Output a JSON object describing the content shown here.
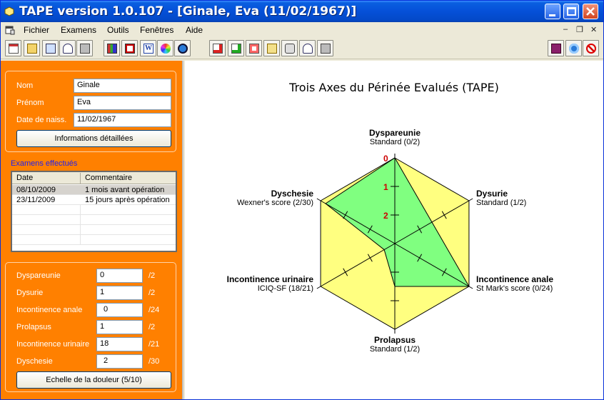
{
  "window": {
    "title": "TAPE version 1.0.107 - [Ginale, Eva (11/02/1967)]"
  },
  "menu": {
    "items": [
      "Fichier",
      "Examens",
      "Outils",
      "Fenêtres",
      "Aide"
    ]
  },
  "patient": {
    "nom_label": "Nom",
    "nom": "Ginale",
    "prenom_label": "Prénom",
    "prenom": "Eva",
    "naiss_label": "Date de naiss.",
    "naiss": "11/02/1967",
    "details_button": "Informations détaillées"
  },
  "exams": {
    "title": "Examens effectués",
    "col_date": "Date",
    "col_comment": "Commentaire",
    "rows": [
      {
        "date": "08/10/2009",
        "comment": "1 mois avant opération"
      },
      {
        "date": "23/11/2009",
        "comment": "15 jours après opération"
      }
    ]
  },
  "scores": {
    "items": [
      {
        "label": "Dyspareunie",
        "value": "0",
        "max": "/2"
      },
      {
        "label": "Dysurie",
        "value": "1",
        "max": "/2"
      },
      {
        "label": "Incontinence anale",
        "value": "0",
        "max": "/24"
      },
      {
        "label": "Prolapsus",
        "value": "1",
        "max": "/2"
      },
      {
        "label": "Incontinence urinaire",
        "value": "18",
        "max": "/21"
      },
      {
        "label": "Dyschesie",
        "value": "2",
        "max": "/30"
      }
    ],
    "pain_button": "Echelle de la douleur (5/10)"
  },
  "chart_data": {
    "type": "radar",
    "title": "Trois Axes du Périnée Evalués (TAPE)",
    "scale_ticks": [
      "0",
      "1",
      "2"
    ],
    "axes": [
      {
        "name": "Dyspareunie",
        "scale": "Standard (0/2)",
        "score": 0,
        "max": 2
      },
      {
        "name": "Dysurie",
        "scale": "Standard (1/2)",
        "score": 1,
        "max": 2
      },
      {
        "name": "Incontinence anale",
        "scale": "St Mark's score (0/24)",
        "score": 0,
        "max": 24
      },
      {
        "name": "Prolapsus",
        "scale": "Standard (1/2)",
        "score": 1,
        "max": 2
      },
      {
        "name": "Incontinence urinaire",
        "scale": "ICIQ-SF (18/21)",
        "score": 18,
        "max": 21
      },
      {
        "name": "Dyschesie",
        "scale": "Wexner's score (2/30)",
        "score": 2,
        "max": 30
      }
    ],
    "series": [
      {
        "fraction_from_outer": [
          0,
          0.5,
          0,
          0.5,
          0.857,
          0.067
        ],
        "fill": "#80ff80"
      }
    ],
    "background_fill": "#ffff80"
  }
}
